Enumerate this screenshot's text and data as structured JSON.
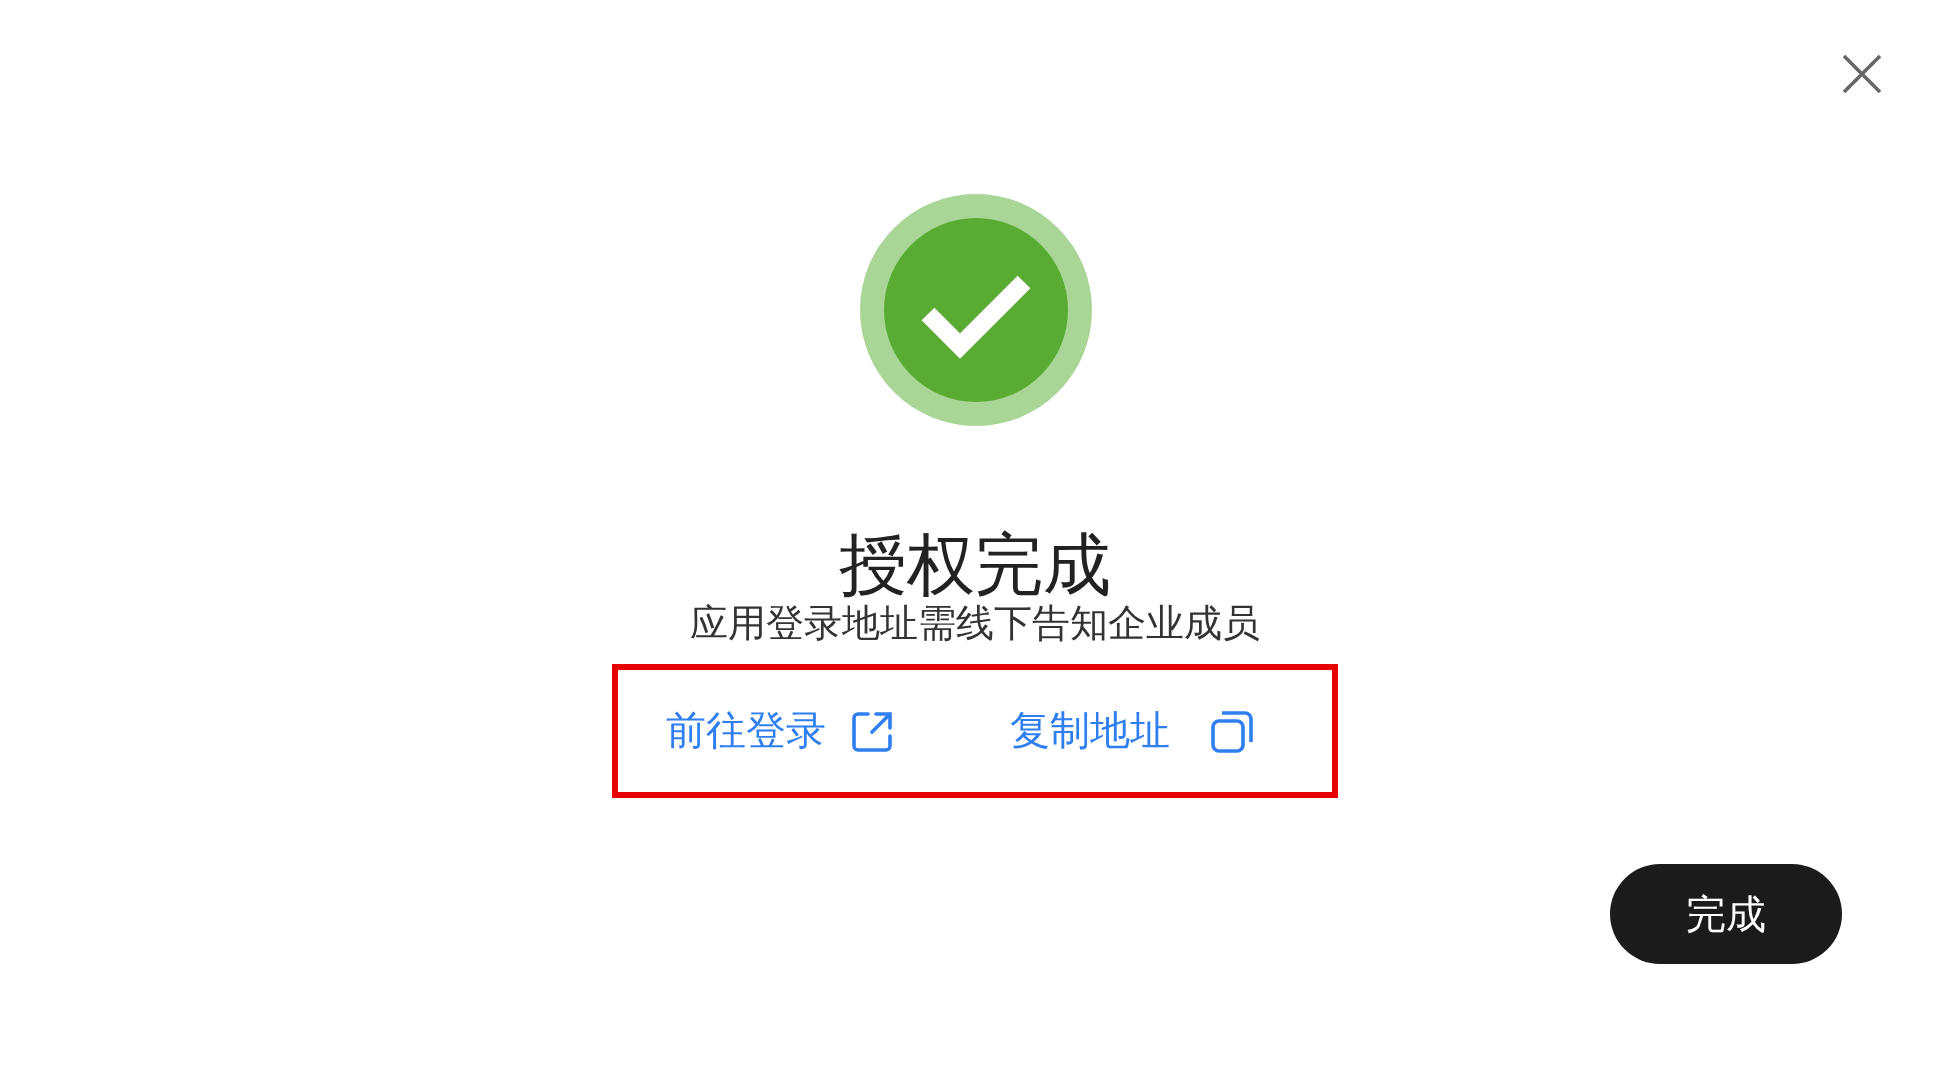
{
  "dialog": {
    "completed": true,
    "title": "授权完成",
    "message": "应用登录地址需线下告知企业成员",
    "links_highlighted": true,
    "links": [
      {
        "label": "前往登录",
        "kind": "external"
      },
      {
        "label": "复制地址",
        "kind": "copy"
      }
    ],
    "done_button": "完成"
  }
}
